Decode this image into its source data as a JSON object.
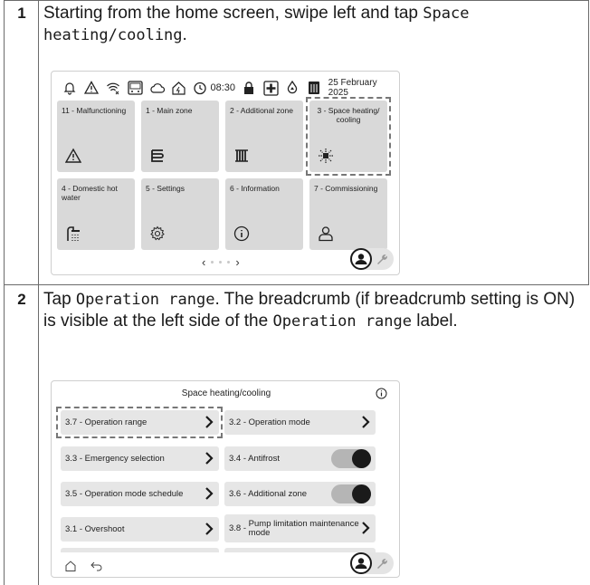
{
  "steps": [
    {
      "number": "1",
      "text_pre": "Starting from the home screen, swipe left and tap ",
      "text_code": "Space heating/cooling",
      "text_post": "."
    },
    {
      "number": "2",
      "text_pre": "Tap ",
      "text_code": "Operation range",
      "text_mid": ". The breadcrumb (if breadcrumb setting is ON) is visible at the left side of the ",
      "text_code2": "Operation range",
      "text_post": " label."
    }
  ],
  "home_screen": {
    "status_time": "08:30",
    "status_date": "25  February 2025",
    "tiles": [
      {
        "label": "11 - Malfunctioning",
        "icon": "warning-icon"
      },
      {
        "label": "1 - Main zone",
        "icon": "radiator-floor-icon"
      },
      {
        "label": "2 - Additional zone",
        "icon": "radiator-icon"
      },
      {
        "label": "3 - Space heating/ cooling",
        "icon": "heat-cool-icon"
      },
      {
        "label": "4 - Domestic hot water",
        "icon": "shower-icon"
      },
      {
        "label": "5 - Settings",
        "icon": "gear-icon"
      },
      {
        "label": "6 - Information",
        "icon": "info-icon"
      },
      {
        "label": "7 - Commissioning",
        "icon": "installer-icon"
      }
    ],
    "pager_prev": "‹",
    "pager_next": "›"
  },
  "space_screen": {
    "title": "Space heating/cooling",
    "rows": [
      {
        "label": "3.7 - Operation range",
        "control": "chevron"
      },
      {
        "label": "3.2 - Operation mode",
        "control": "chevron"
      },
      {
        "label": "3.3 - Emergency selection",
        "control": "chevron"
      },
      {
        "label": "3.4 - Antifrost",
        "control": "toggle"
      },
      {
        "label": "3.5 - Operation mode schedule",
        "control": "chevron"
      },
      {
        "label": "3.6 - Additional zone",
        "control": "toggle"
      },
      {
        "label": "3.1 - Overshoot",
        "control": "chevron"
      },
      {
        "label_prefix": "3.8 - ",
        "label_line1": "Pump limitation maintenance",
        "label_line2": "mode",
        "control": "chevron"
      }
    ]
  },
  "colors": {
    "tile": "#d9d9d9",
    "row": "#e6e6e6",
    "dash": "#777777"
  }
}
